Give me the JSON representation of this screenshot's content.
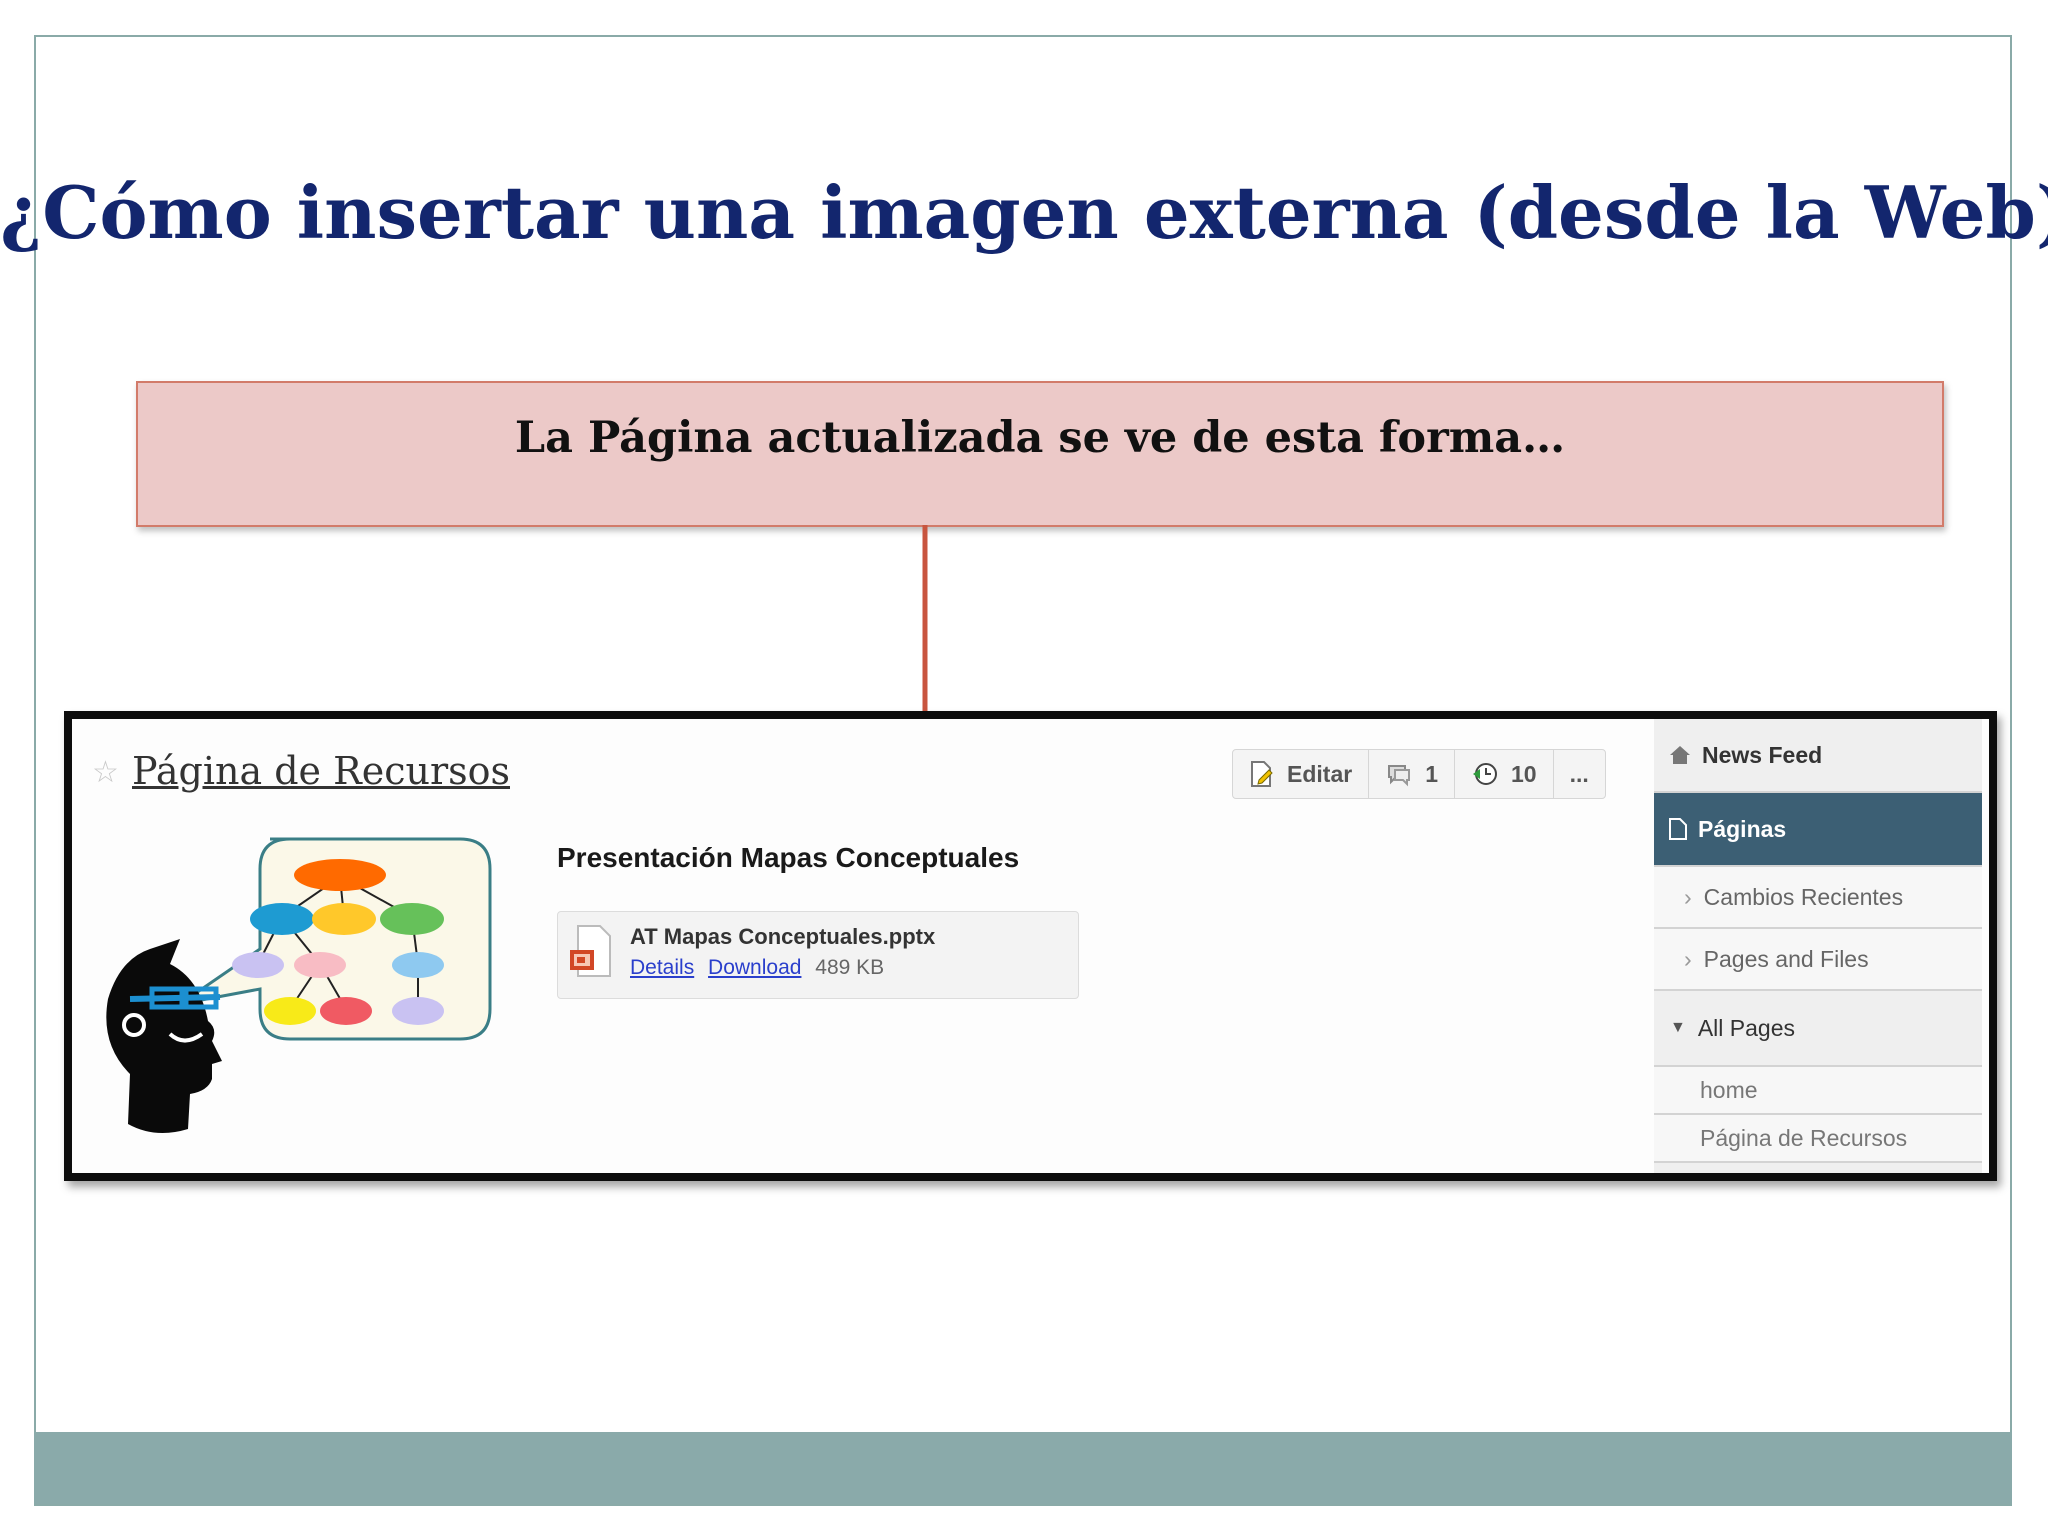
{
  "slide": {
    "title": "¿Cómo insertar una imagen externa (desde la Web)?",
    "callout_text": "La Página actualizada se ve de esta forma…",
    "colors": {
      "title": "#13266e",
      "callout_fill": "#ecc9c8",
      "callout_border": "#d27b6a",
      "arrow": "#c8553f",
      "footer": "#8aaaaa"
    }
  },
  "screenshot": {
    "page_title": "Página de Recursos",
    "toolbar": {
      "edit_label": "Editar",
      "comments_count": "1",
      "history_count": "10",
      "more_label": "..."
    },
    "section_heading": "Presentación Mapas Conceptuales",
    "file": {
      "name": "AT Mapas Conceptuales.pptx",
      "details_link": "Details",
      "download_link": "Download",
      "size": "489 KB",
      "icon": "powerpoint-file-icon"
    },
    "sidebar": {
      "news_feed": "News Feed",
      "pages": "Páginas",
      "recent_changes": "Cambios Recientes",
      "pages_and_files": "Pages and Files",
      "all_pages": "All Pages",
      "pages_list": [
        "home",
        "Página de Recursos"
      ],
      "colors": {
        "active_bg": "#3c5f74"
      }
    },
    "icons": [
      "star-icon",
      "edit-icon",
      "comment-icon",
      "history-icon",
      "home-icon",
      "page-icon",
      "chevron-right-icon",
      "caret-down-icon"
    ]
  }
}
